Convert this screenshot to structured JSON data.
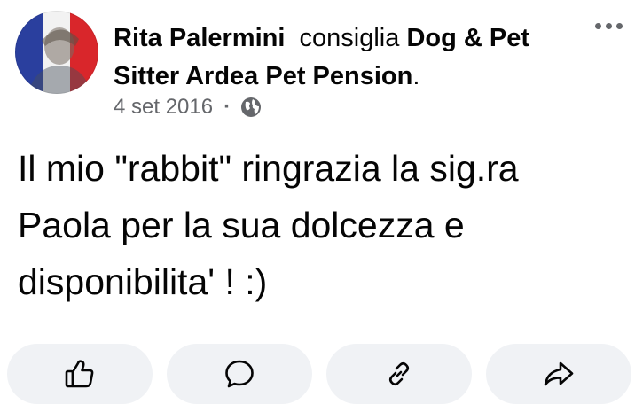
{
  "post": {
    "author": "Rita Palermini",
    "verb": "consiglia",
    "page_name": "Dog & Pet Sitter Ardea Pet Pension",
    "period": ".",
    "date": "4 set 2016",
    "separator": "·",
    "privacy_icon": "globe-icon",
    "body": "Il mio \"rabbit\" ringrazia la sig.ra Paola per la sua dolcezza e disponibilita' ! :)"
  },
  "actions": [
    {
      "name": "like-button",
      "icon": "thumbs-up-icon"
    },
    {
      "name": "comment-button",
      "icon": "comment-bubble-icon"
    },
    {
      "name": "copy-link-button",
      "icon": "link-icon"
    },
    {
      "name": "share-button",
      "icon": "share-arrow-icon"
    }
  ],
  "colors": {
    "text": "#050505",
    "secondary_text": "#65676b",
    "button_bg": "#f0f2f5",
    "avatar_flag": [
      "#2a3f9e",
      "#f2f2f2",
      "#d9262b"
    ]
  }
}
